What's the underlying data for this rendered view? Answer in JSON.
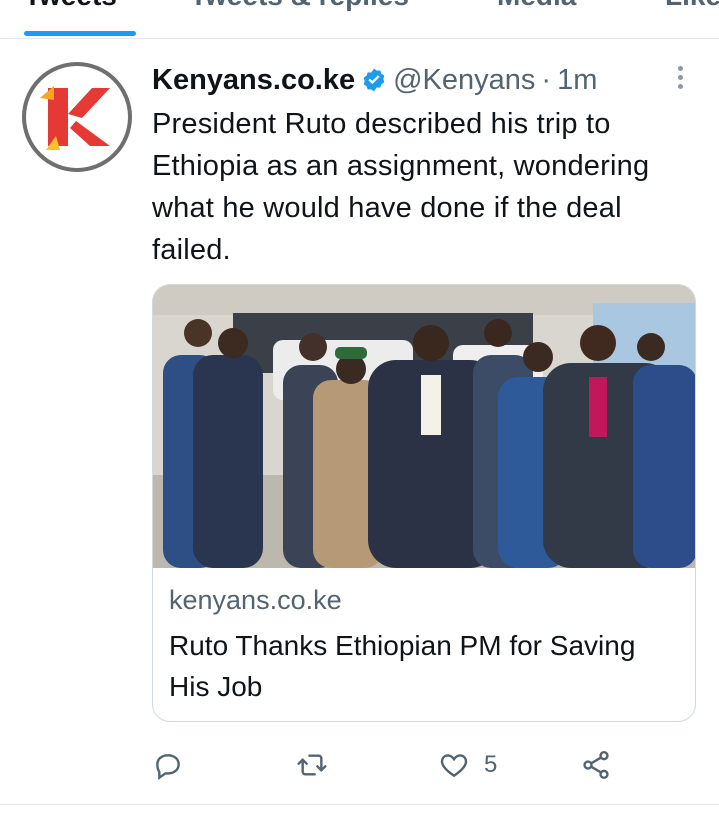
{
  "tabs": [
    {
      "label": "Tweets",
      "active": true
    },
    {
      "label": "Tweets & replies",
      "active": false
    },
    {
      "label": "Media",
      "active": false
    },
    {
      "label": "Likes",
      "active": false
    }
  ],
  "tweet": {
    "author_name": "Kenyans.co.ke",
    "verified": true,
    "handle": "@Kenyans",
    "separator": "·",
    "time": "1m",
    "text": "President Ruto described his trip to Ethiopia as an assignment, wondering what he would have done if the deal failed.",
    "avatar_icon": "kenyans-logo-icon",
    "card": {
      "domain": "kenyans.co.ke",
      "title": "Ruto Thanks Ethiopian PM for Saving His Job",
      "image_icon": "news-photo"
    },
    "actions": {
      "reply_icon": "reply-icon",
      "retweet_icon": "retweet-icon",
      "like_icon": "heart-icon",
      "like_count": "5",
      "share_icon": "share-icon"
    }
  },
  "colors": {
    "accent": "#1d9bf0",
    "brand_red": "#e53935",
    "text_secondary": "#536471"
  }
}
